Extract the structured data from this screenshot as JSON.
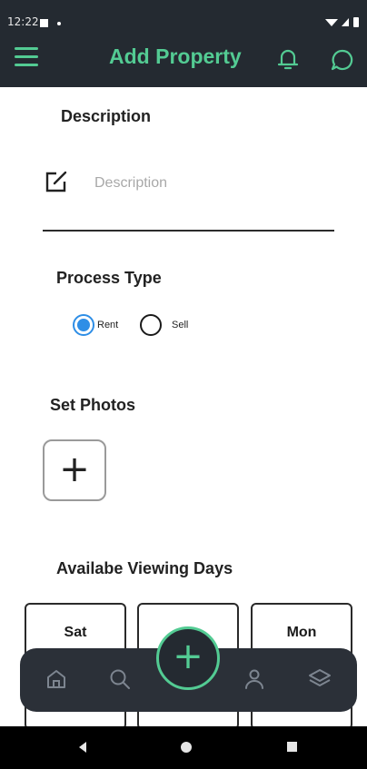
{
  "status_bar": {
    "time": "12:22"
  },
  "header": {
    "title": "Add Property"
  },
  "description": {
    "label": "Description",
    "placeholder": "Description",
    "value": ""
  },
  "process_type": {
    "label": "Process Type",
    "options": [
      {
        "label": "Rent",
        "selected": true
      },
      {
        "label": "Sell",
        "selected": false
      }
    ]
  },
  "photos": {
    "label": "Set Photos",
    "add_glyph": "+"
  },
  "viewing_days": {
    "label": "Availabe Viewing Days",
    "days": [
      "Sat",
      "",
      "Mon"
    ]
  },
  "bottom_nav": {
    "fab_glyph": "+",
    "items": [
      "home-icon",
      "search-icon",
      "profile-icon",
      "layers-icon"
    ]
  },
  "colors": {
    "accent": "#53cb93",
    "header_bg": "#242a31",
    "nav_bg": "#2b3038",
    "radio_selected": "#2e8ee6"
  }
}
